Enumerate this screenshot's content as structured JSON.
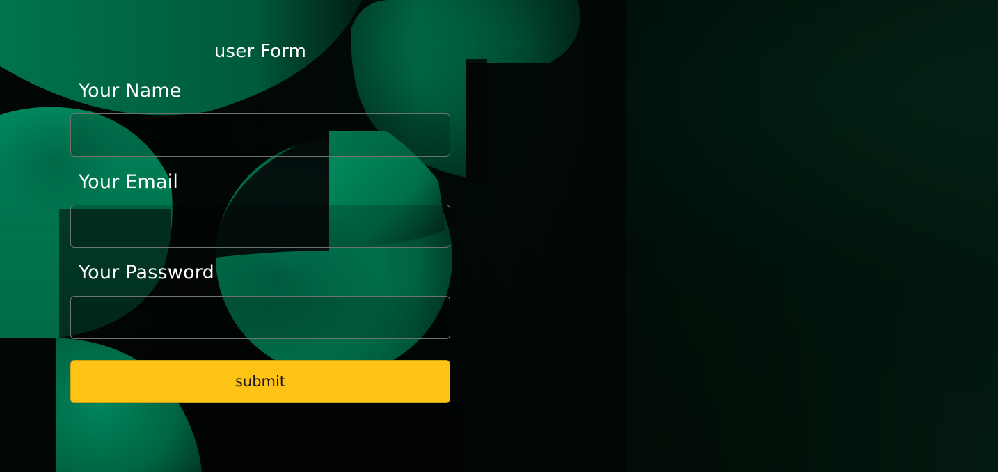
{
  "form": {
    "title": "user Form",
    "fields": [
      {
        "label": "Your Name",
        "value": "",
        "placeholder": ""
      },
      {
        "label": "Your Email",
        "value": "",
        "placeholder": ""
      },
      {
        "label": "Your Password",
        "value": "",
        "placeholder": ""
      }
    ],
    "submit_label": "submit"
  },
  "colors": {
    "accent_button": "#ffc315",
    "background": "#010403",
    "art_green": "#008a5e"
  }
}
